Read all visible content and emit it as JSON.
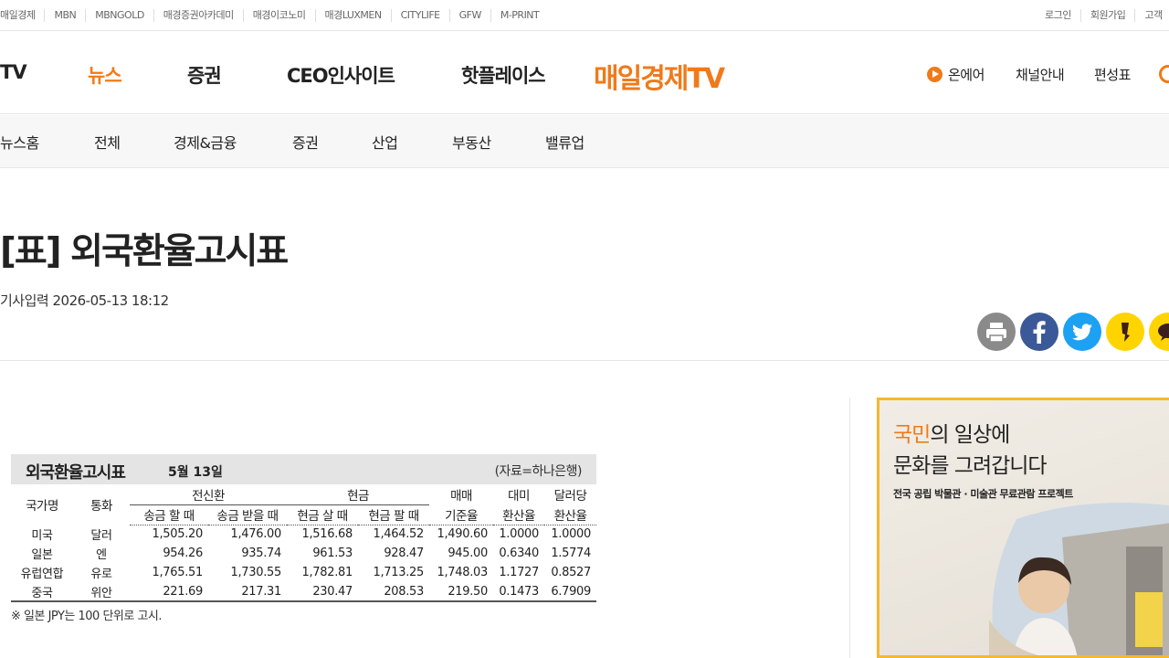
{
  "util_bar": {
    "left_links": [
      "매일경제",
      "MBN",
      "MBNGOLD",
      "매경증권아카데미",
      "매경이코노미",
      "매경LUXMEN",
      "CITYLIFE",
      "GFW",
      "M-PRINT"
    ],
    "right_links": [
      "로그인",
      "회원가입",
      "고객"
    ]
  },
  "gnb": {
    "menu": [
      "TV",
      "뉴스",
      "증권",
      "CEO인사이트",
      "핫플레이스"
    ],
    "active": "뉴스",
    "logo": "매일경제TV",
    "onair": "온에어",
    "channel": "채널안내",
    "schedule": "편성표"
  },
  "subnav": [
    "뉴스홈",
    "전체",
    "경제&금융",
    "증권",
    "산업",
    "부동산",
    "밸류업"
  ],
  "article": {
    "title": "[표] 외국환율고시표",
    "date_label": "기사입력",
    "date": "2026-05-13 18:12",
    "share": [
      "print-icon",
      "facebook-icon",
      "twitter-icon",
      "kakaostory-icon",
      "kakaotalk-icon"
    ]
  },
  "rate_table": {
    "title": "외국환율고시표",
    "date": "5월 13일",
    "source": "(자료=하나은행)",
    "headers": {
      "country": "국가명",
      "currency": "통화",
      "wire": "전신환",
      "cash": "현금",
      "base_1": "매매",
      "base_2": "기준율",
      "usd_1": "대미",
      "usd_2": "환산율",
      "per_usd_1": "달러당",
      "per_usd_2": "환산율",
      "wire_send": "송금 할 때",
      "wire_recv": "송금 받을 때",
      "cash_buy": "현금 살 때",
      "cash_sell": "현금 팔 때"
    },
    "rows": [
      [
        "미국",
        "달러",
        "1,505.20",
        "1,476.00",
        "1,516.68",
        "1,464.52",
        "1,490.60",
        "1.0000",
        "1.0000"
      ],
      [
        "일본",
        "엔",
        "954.26",
        "935.74",
        "961.53",
        "928.47",
        "945.00",
        "0.6340",
        "1.5774"
      ],
      [
        "유럽연합",
        "유로",
        "1,765.51",
        "1,730.55",
        "1,782.81",
        "1,713.25",
        "1,748.03",
        "1.1727",
        "0.8527"
      ],
      [
        "중국",
        "위안",
        "221.69",
        "217.31",
        "230.47",
        "208.53",
        "219.50",
        "0.1473",
        "6.7909"
      ]
    ],
    "note": "※ 일본 JPY는 100 단위로 고시."
  },
  "banner": {
    "line1_highlight": "국민",
    "line1_rest": "의 일상에",
    "line2": "문화를 그려갑니다",
    "sub": "전국 공립 박물관 · 미술관 무료관람 프로젝트",
    "accent": "#f5b82e"
  },
  "colors": {
    "brand": "#f07a1a"
  }
}
